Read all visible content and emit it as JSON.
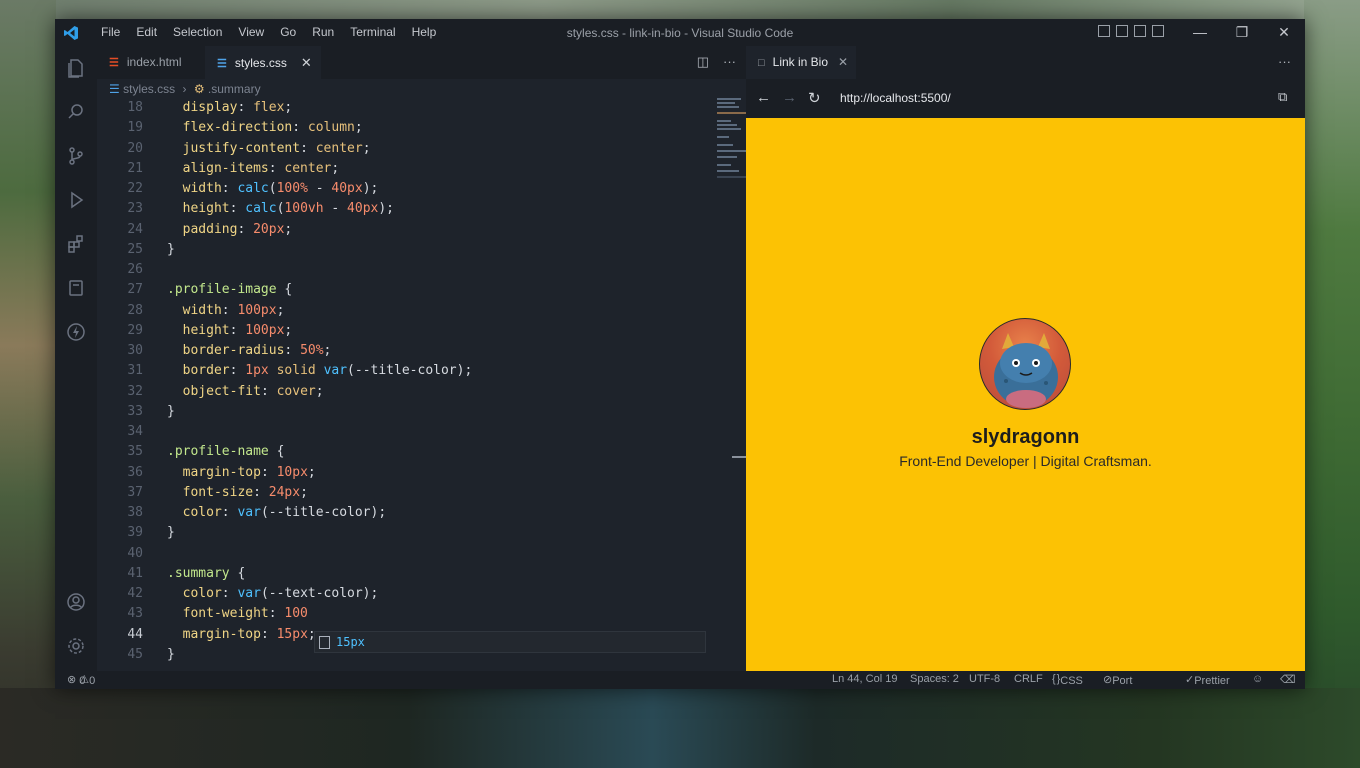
{
  "window": {
    "title": "styles.css - link-in-bio - Visual Studio Code",
    "menu": [
      "File",
      "Edit",
      "Selection",
      "View",
      "Go",
      "Run",
      "Terminal",
      "Help"
    ],
    "controls": {
      "minimize": "—",
      "restore": "❐",
      "close": "✕"
    }
  },
  "editor": {
    "tabs": [
      {
        "label": "index.html",
        "icon": "html-file-icon",
        "active": false
      },
      {
        "label": "styles.css",
        "icon": "css-file-icon",
        "active": true
      }
    ],
    "breadcrumb": {
      "file": "styles.css",
      "symbol": ".summary"
    },
    "lines": [
      {
        "n": "18",
        "code": "  display: flex;"
      },
      {
        "n": "19",
        "code": "  flex-direction: column;"
      },
      {
        "n": "20",
        "code": "  justify-content: center;"
      },
      {
        "n": "21",
        "code": "  align-items: center;"
      },
      {
        "n": "22",
        "code": "  width: calc(100% - 40px);"
      },
      {
        "n": "23",
        "code": "  height: calc(100vh - 40px);"
      },
      {
        "n": "24",
        "code": "  padding: 20px;"
      },
      {
        "n": "25",
        "code": "}"
      },
      {
        "n": "26",
        "code": ""
      },
      {
        "n": "27",
        "code": ".profile-image {"
      },
      {
        "n": "28",
        "code": "  width: 100px;"
      },
      {
        "n": "29",
        "code": "  height: 100px;"
      },
      {
        "n": "30",
        "code": "  border-radius: 50%;"
      },
      {
        "n": "31",
        "code": "  border: 1px solid var(--title-color);"
      },
      {
        "n": "32",
        "code": "  object-fit: cover;"
      },
      {
        "n": "33",
        "code": "}"
      },
      {
        "n": "34",
        "code": ""
      },
      {
        "n": "35",
        "code": ".profile-name {"
      },
      {
        "n": "36",
        "code": "  margin-top: 10px;"
      },
      {
        "n": "37",
        "code": "  font-size: 24px;"
      },
      {
        "n": "38",
        "code": "  color: var(--title-color);"
      },
      {
        "n": "39",
        "code": "}"
      },
      {
        "n": "40",
        "code": ""
      },
      {
        "n": "41",
        "code": ".summary {"
      },
      {
        "n": "42",
        "code": "  color: var(--text-color);"
      },
      {
        "n": "43",
        "code": "  font-weight: 100"
      },
      {
        "n": "44",
        "code": "  margin-top: 15px;"
      },
      {
        "n": "45",
        "code": "}"
      }
    ],
    "current_line": "44",
    "suggestion": "15px"
  },
  "preview": {
    "tab_label": "Link in Bio",
    "url": "http://localhost:5500/",
    "page_bg": "#fcc204",
    "profile_name": "slydragonn",
    "summary": "Front-End Developer | Digital Craftsman."
  },
  "status": {
    "errors": "0",
    "warnings": "0",
    "position": "Ln 44, Col 19",
    "spaces": "Spaces: 2",
    "encoding": "UTF-8",
    "eol": "CRLF",
    "language": "CSS",
    "port": "Port : 5500",
    "formatter": "Prettier"
  }
}
